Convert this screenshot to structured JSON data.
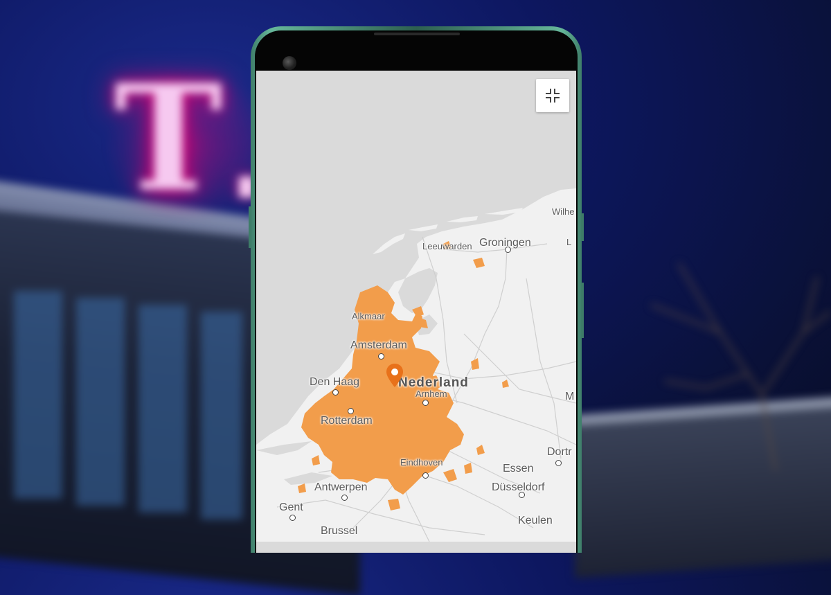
{
  "background": {
    "brand_logo": "T",
    "brand_color": "#e20074"
  },
  "phone": {
    "frame_color": "#5aa88d"
  },
  "map": {
    "fullscreen_icon": "exit-fullscreen-icon",
    "pin_icon": "location-pin-icon",
    "coverage_color": "#f29d4b",
    "land_color": "#f1f1f1",
    "water_color": "#dadada",
    "labels": {
      "wilhelmshaven": "Wilhe",
      "leeuwarden": "Leeuwarden",
      "groningen": "Groningen",
      "lingen": "L",
      "alkmaar": "Alkmaar",
      "amsterdam": "Amsterdam",
      "country": "Nederland",
      "den_haag": "Den Haag",
      "arnhem": "Arnhem",
      "munster": "M",
      "rotterdam": "Rotterdam",
      "dortmund": "Dortr",
      "eindhoven": "Eindhoven",
      "essen": "Essen",
      "antwerpen": "Antwerpen",
      "dusseldorf": "Düsseldorf",
      "gent": "Gent",
      "keulen": "Keulen",
      "brussel": "Brussel"
    }
  }
}
